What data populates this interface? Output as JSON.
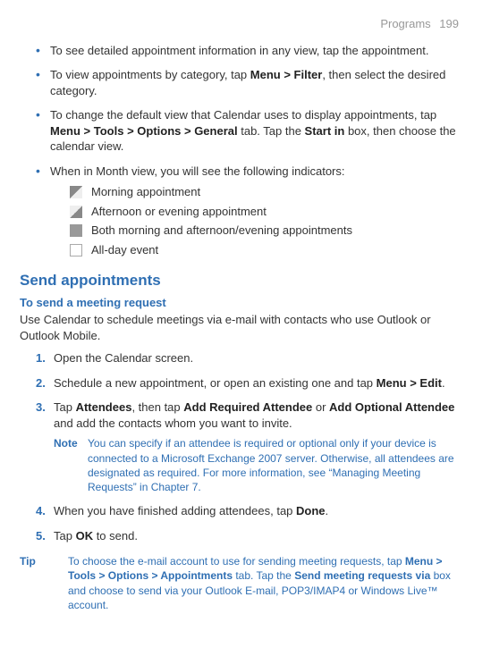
{
  "header": {
    "section": "Programs",
    "page": "199"
  },
  "bullets": {
    "b1": "To see detailed appointment information in any view, tap the appointment.",
    "b2_a": "To view appointments by category, tap ",
    "b2_bold": "Menu > Filter",
    "b2_b": ", then select the desired category.",
    "b3_a": "To change the default view that Calendar uses to display appointments, tap ",
    "b3_bold1": "Menu > Tools > Options > General",
    "b3_b": " tab. Tap the ",
    "b3_bold2": "Start in",
    "b3_c": " box, then choose the calendar view.",
    "b4": "When in Month view, you will see the following indicators:"
  },
  "indicators": {
    "morning": "Morning appointment",
    "afternoon": "Afternoon or evening appointment",
    "both": "Both morning and afternoon/evening appointments",
    "allday": "All-day event"
  },
  "send": {
    "title": "Send appointments",
    "subtitle": "To send a meeting request",
    "intro": "Use Calendar to schedule meetings via e-mail with contacts who use Outlook or Outlook Mobile."
  },
  "steps": {
    "s1": "Open the Calendar screen.",
    "s2_a": "Schedule a new appointment, or open an existing one and tap ",
    "s2_bold1": "Menu > Edit",
    "s2_b": ".",
    "s3_a": "Tap ",
    "s3_bold1": "Attendees",
    "s3_b": ", then tap ",
    "s3_bold2": "Add Required Attendee",
    "s3_c": " or ",
    "s3_bold3": "Add Optional Attendee",
    "s3_d": " and add the contacts whom you want to invite.",
    "s3_note_label": "Note",
    "s3_note_text": "You can specify if an attendee is required or optional only if your device is connected to a Microsoft Exchange 2007 server. Otherwise, all attendees are designated as required. For more information, see “Managing Meeting Requests” in Chapter 7.",
    "s4_a": "When you have finished adding attendees, tap ",
    "s4_bold": "Done",
    "s4_b": ".",
    "s5_a": "Tap ",
    "s5_bold": "OK",
    "s5_b": " to send."
  },
  "tip": {
    "label": "Tip",
    "t_a": "To choose the e-mail account to use for sending meeting requests, tap ",
    "t_bold1": "Menu > Tools > Options > Appointments",
    "t_b": " tab. Tap the ",
    "t_bold2": "Send meeting requests via",
    "t_c": " box and choose to send via your Outlook E-mail, POP3/IMAP4 or Windows Live™ account."
  }
}
